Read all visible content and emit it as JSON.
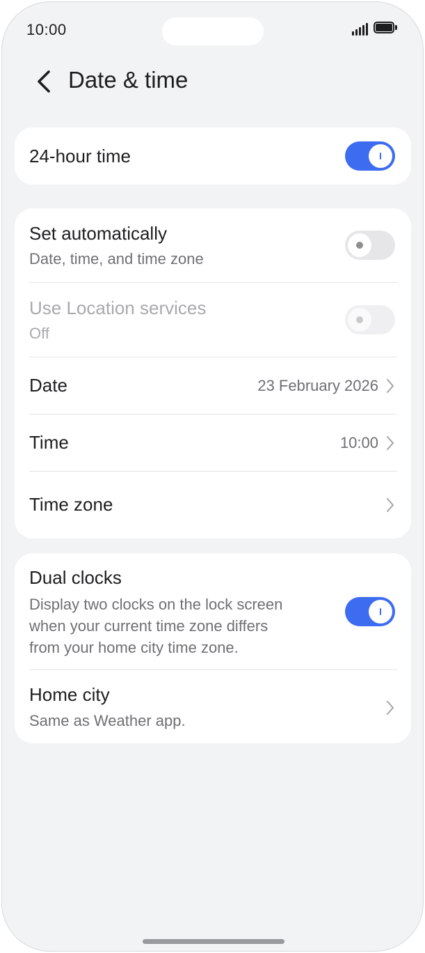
{
  "status_bar": {
    "time": "10:00",
    "signal_icon": "cellular-signal-icon",
    "battery_icon": "battery-full-icon"
  },
  "header": {
    "title": "Date & time",
    "back_icon": "chevron-left-icon"
  },
  "hour_format": {
    "label": "24-hour time",
    "enabled": true
  },
  "automatic": {
    "set_automatically": {
      "label": "Set automatically",
      "subtitle": "Date, time, and time zone",
      "enabled": false
    },
    "location": {
      "label": "Use Location services",
      "subtitle": "Off",
      "enabled": false,
      "disabled": true
    },
    "date": {
      "label": "Date",
      "value": "23 February 2026"
    },
    "time": {
      "label": "Time",
      "value": "10:00"
    },
    "time_zone": {
      "label": "Time zone",
      "value": ""
    }
  },
  "dual_clocks": {
    "label": "Dual clocks",
    "description_lines": [
      "Display two clocks on the lock screen",
      "when your current time zone differs",
      "from your home city time zone."
    ],
    "enabled": true,
    "home_city": {
      "label": "Home city",
      "subtitle": "Same as Weather app."
    }
  },
  "colors": {
    "accent": "#3e6cf1",
    "background": "#f2f3f5",
    "card": "#ffffff"
  }
}
